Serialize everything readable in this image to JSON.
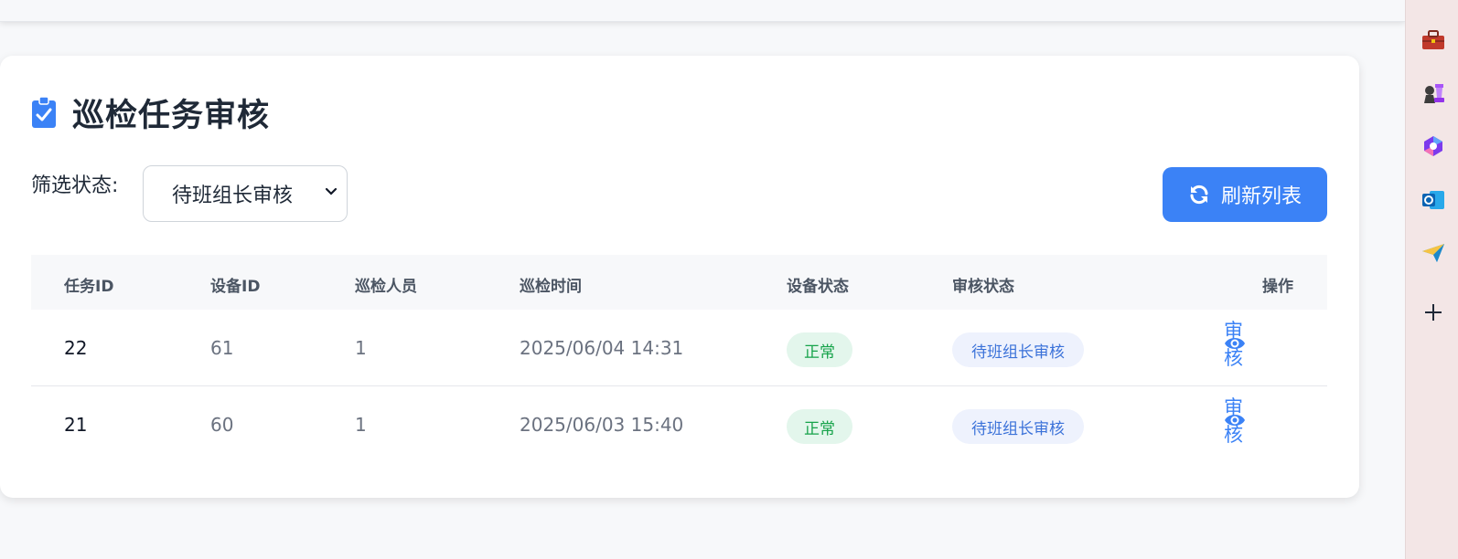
{
  "page": {
    "title": "巡检任务审核",
    "filter_label": "筛选状态:",
    "filter_value": "待班组长审核",
    "refresh_label": "刷新列表"
  },
  "table": {
    "headers": [
      "任务ID",
      "设备ID",
      "巡检人员",
      "巡检时间",
      "设备状态",
      "审核状态",
      "操作"
    ],
    "rows": [
      {
        "task_id": "22",
        "device_id": "61",
        "inspector": "1",
        "time": "2025/06/04 14:31",
        "device_status": "正常",
        "review_status": "待班组长审核",
        "action": "审核"
      },
      {
        "task_id": "21",
        "device_id": "60",
        "inspector": "1",
        "time": "2025/06/03 15:40",
        "device_status": "正常",
        "review_status": "待班组长审核",
        "action": "审核"
      }
    ]
  },
  "sidebar_icons": [
    "toolbox-icon",
    "chess-icon",
    "copilot-icon",
    "outlook-icon",
    "send-icon",
    "add-icon"
  ],
  "colors": {
    "accent": "#3b82f6",
    "status_ok_bg": "#e3f6ec",
    "status_ok_text": "#16a34a",
    "review_bg": "#eef2fd",
    "review_text": "#3b72d9"
  }
}
